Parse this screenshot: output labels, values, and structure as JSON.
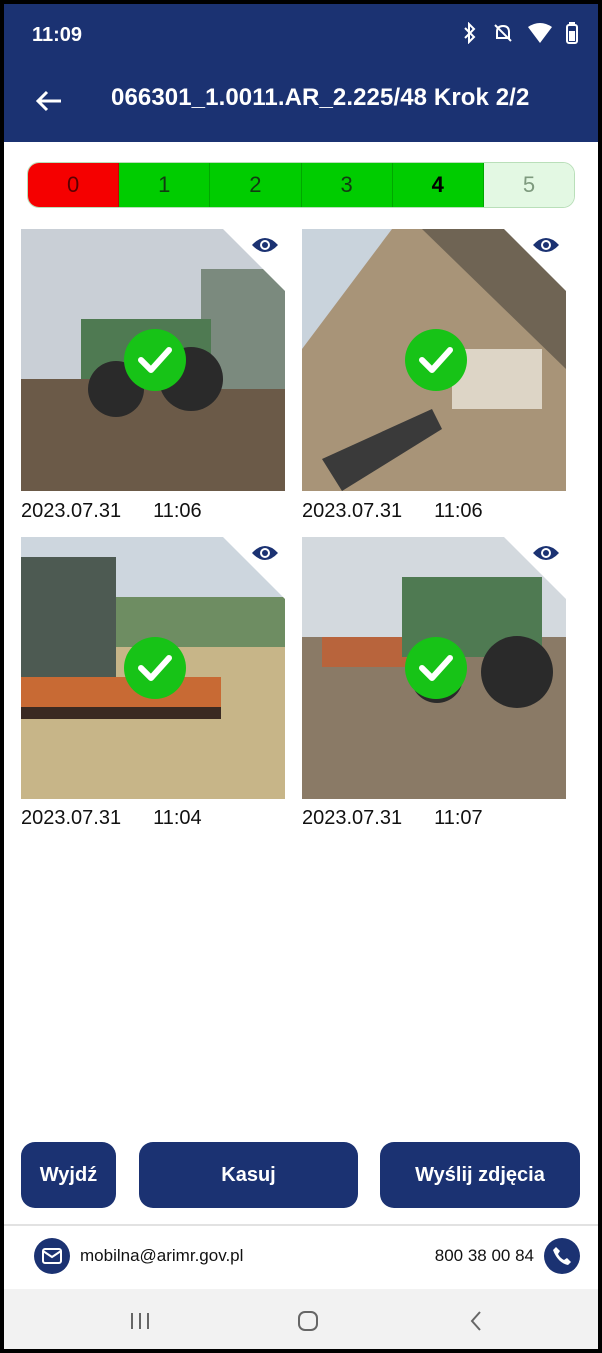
{
  "status": {
    "time": "11:09"
  },
  "header": {
    "title": "066301_1.0011.AR_2.225/48 Krok 2/2"
  },
  "steps": [
    "0",
    "1",
    "2",
    "3",
    "4",
    "5"
  ],
  "photos": [
    {
      "date": "2023.07.31",
      "time": "11:06"
    },
    {
      "date": "2023.07.31",
      "time": "11:06"
    },
    {
      "date": "2023.07.31",
      "time": "11:04"
    },
    {
      "date": "2023.07.31",
      "time": "11:07"
    }
  ],
  "buttons": {
    "exit": "Wyjdź",
    "delete": "Kasuj",
    "send": "Wyślij zdjęcia"
  },
  "contact": {
    "email": "mobilna@arimr.gov.pl",
    "phone": "800 38 00 84"
  },
  "colors": {
    "primary": "#1b3272",
    "red": "#f50000",
    "green": "#00cc00",
    "pending": "#e3f8e3",
    "check": "#17c317"
  }
}
